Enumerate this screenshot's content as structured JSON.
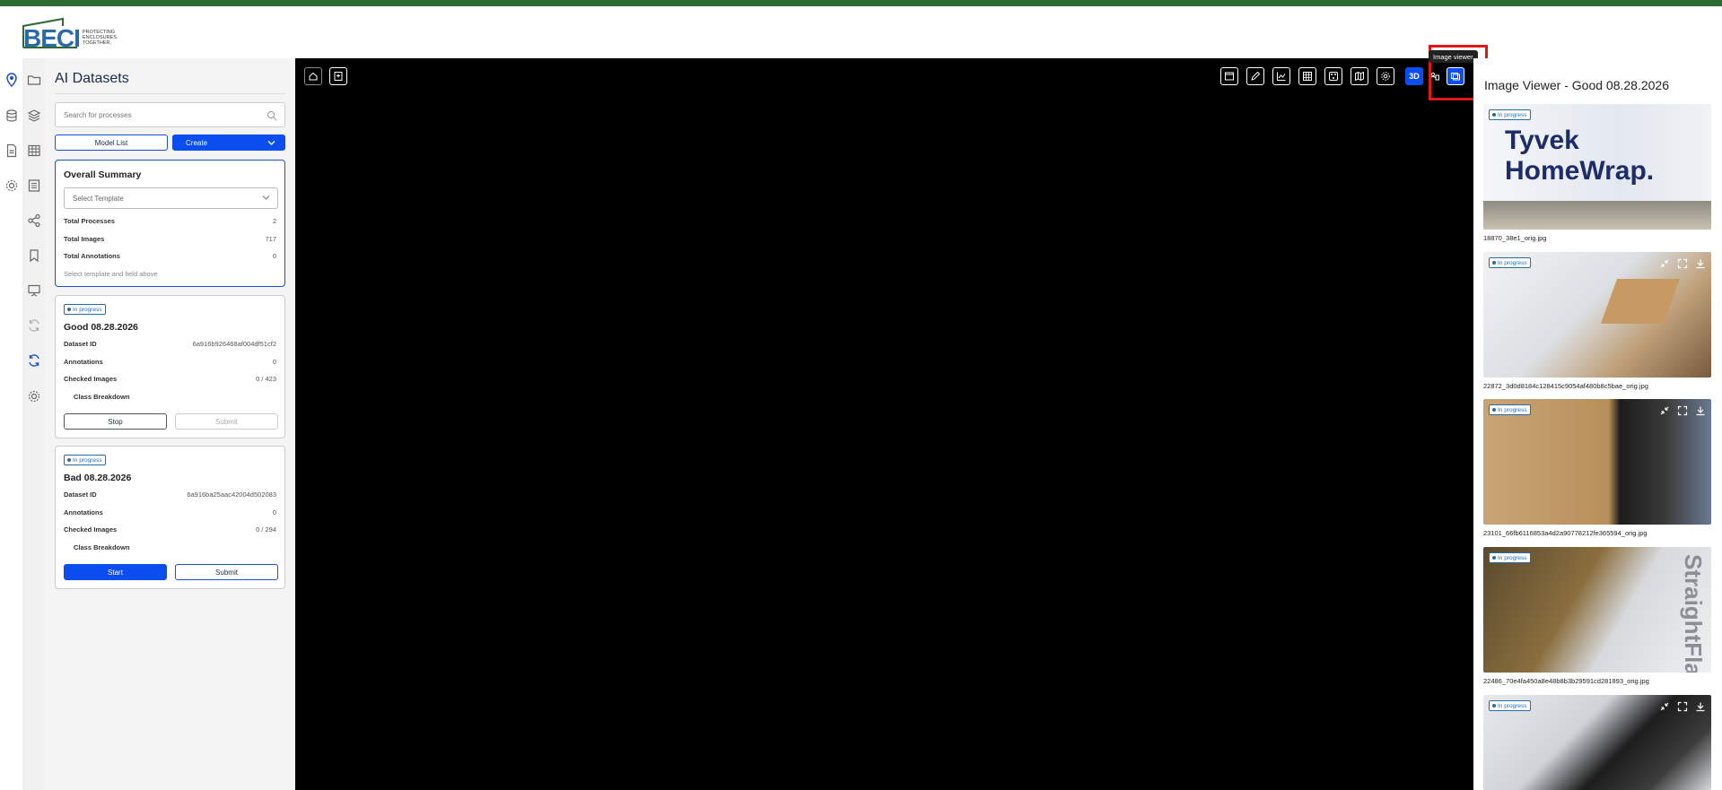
{
  "brand": {
    "name": "BECI",
    "tagline": "PROTECTING ENCLOSURES. TOGETHER.",
    "colors": {
      "green": "#2e6b34",
      "blue": "#2b6aa8",
      "primary": "#0b4ef0",
      "highlight": "#e01818"
    }
  },
  "rail_icons": [
    "location-pin-icon",
    "folder-icon",
    "database-icon",
    "layers-icon",
    "document-icon",
    "table-icon",
    "settings-icon",
    "list-icon",
    "share-icon",
    "bookmark-icon",
    "presentation-icon",
    "sync-icon",
    "sync-active-icon",
    "gear-icon"
  ],
  "left_panel": {
    "title": "AI Datasets",
    "search_placeholder": "Search for processes",
    "model_list_label": "Model List",
    "create_label": "Create",
    "summary": {
      "title": "Overall Summary",
      "template_placeholder": "Select Template",
      "rows": [
        {
          "label": "Total Processes",
          "value": "2"
        },
        {
          "label": "Total Images",
          "value": "717"
        },
        {
          "label": "Total Annotations",
          "value": "0"
        }
      ],
      "hint": "Select template and field above"
    },
    "datasets": [
      {
        "status": "In progress",
        "title": "Good 08.28.2026",
        "dataset_id_label": "Dataset ID",
        "dataset_id": "6a916b926468af004df51cf2",
        "annotations_label": "Annotations",
        "annotations": "0",
        "checked_label": "Checked Images",
        "checked": "0 / 423",
        "breakdown_label": "Class Breakdown",
        "primary_action": "Stop",
        "secondary_action": "Submit"
      },
      {
        "status": "In progress",
        "title": "Bad 08.28.2026",
        "dataset_id_label": "Dataset ID",
        "dataset_id": "6a916ba25aac42004d502083",
        "annotations_label": "Annotations",
        "annotations": "0",
        "checked_label": "Checked Images",
        "checked": "0 / 294",
        "breakdown_label": "Class Breakdown",
        "primary_action": "Start",
        "secondary_action": "Submit"
      }
    ]
  },
  "viewport": {
    "left_tools": [
      "home-icon",
      "bookmark-add-icon"
    ],
    "right_tools": [
      "window-icon",
      "pen-icon",
      "chart-icon",
      "grid-icon",
      "palette-icon",
      "map-icon",
      "settings-icon"
    ],
    "three_d_label": "3D",
    "tooltip": "Image viewer"
  },
  "image_viewer": {
    "title": "Image Viewer - Good 08.28.2026",
    "images": [
      {
        "status": "In progress",
        "filename": "18870_38e1_orig.jpg",
        "overlay_text": "Tyvek HomeWrap."
      },
      {
        "status": "In progress",
        "filename": "22872_3d0d8184c128415c9054af480b8c5bae_orig.jpg",
        "overlay_text": ""
      },
      {
        "status": "In progress",
        "filename": "23101_66fb6116853a4d2a90778212fe365594_orig.jpg",
        "overlay_text": ""
      },
      {
        "status": "In progress",
        "filename": "22486_70e4fa450a8e48b8b3b29591cd281893_orig.jpg",
        "overlay_text": "StraightFlash"
      },
      {
        "status": "In progress",
        "filename": "",
        "overlay_text": ""
      }
    ]
  }
}
